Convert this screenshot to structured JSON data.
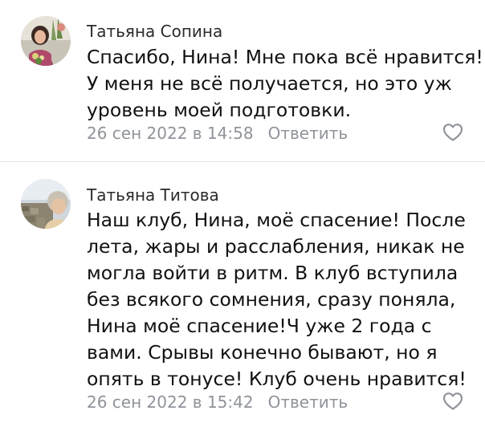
{
  "comments": [
    {
      "author": "Татьяна Сопина",
      "lines": [
        "Спасибо, Нина! Мне пока всё нравится!",
        "У меня не всё получается, но это уж",
        "уровень моей подготовки."
      ],
      "date": "26 сен 2022 в 14:58",
      "reply_label": "Ответить",
      "like_icon": "heart-outline-icon"
    },
    {
      "author": "Татьяна Титова",
      "lines": [
        "Наш клуб, Нина, моё спасение! После",
        "лета, жары и расслабления, никак не",
        "могла войти в ритм. В клуб вступила",
        "без всякого сомнения, сразу поняла,",
        "Нина моё спасение!Ч уже 2 года с",
        "вами. Срывы конечно бывают, но я",
        "опять в тонусе! Клуб очень нравится!"
      ],
      "date": "26 сен 2022 в 15:42",
      "reply_label": "Ответить",
      "like_icon": "heart-outline-icon"
    }
  ],
  "colors": {
    "text": "#111111",
    "author": "#2b2b2b",
    "meta": "#8f939a",
    "divider": "#e4e5e8"
  }
}
